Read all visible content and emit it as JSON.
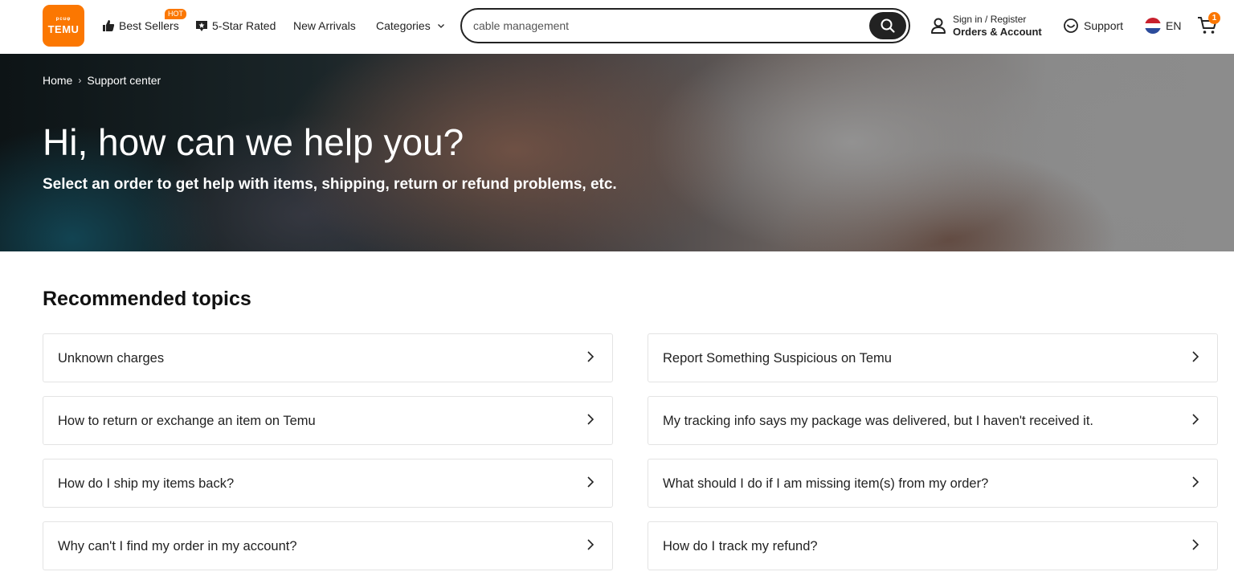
{
  "header": {
    "logo_glyphs": "ᵖᶜᵘᵠ",
    "logo_text": "TEMU",
    "nav": {
      "best_sellers": "Best Sellers",
      "hot_badge": "HOT",
      "five_star": "5-Star Rated",
      "new_arrivals": "New Arrivals",
      "categories": "Categories"
    },
    "search": {
      "value": "cable management"
    },
    "account": {
      "line1": "Sign in / Register",
      "line2": "Orders & Account"
    },
    "support_label": "Support",
    "language": "EN",
    "cart_count": "1"
  },
  "hero": {
    "breadcrumb": [
      "Home",
      "Support center"
    ],
    "title": "Hi, how can we help you?",
    "subtitle": "Select an order to get help with items, shipping, return or refund problems, etc."
  },
  "topics": {
    "title": "Recommended topics",
    "left": [
      "Unknown charges",
      "How to return or exchange an item on Temu",
      "How do I ship my items back?",
      "Why can't I find my order in my account?"
    ],
    "right": [
      "Report Something Suspicious on Temu",
      "My tracking info says my package was delivered, but I haven't received it.",
      "What should I do if I am missing item(s) from my order?",
      "How do I track my refund?"
    ]
  },
  "colors": {
    "brand": "#fb7701",
    "text": "#222222",
    "border": "#e3e3e3"
  },
  "icons": {
    "logo": "temu-logo",
    "best_sellers": "thumbs-up-icon",
    "five_star": "star-badge-icon",
    "categories": "chevron-down-icon",
    "search": "search-icon",
    "account": "user-icon",
    "support": "chat-smile-icon",
    "language": "netherlands-flag-icon",
    "cart": "cart-icon",
    "topic_row": "chevron-right-icon"
  }
}
